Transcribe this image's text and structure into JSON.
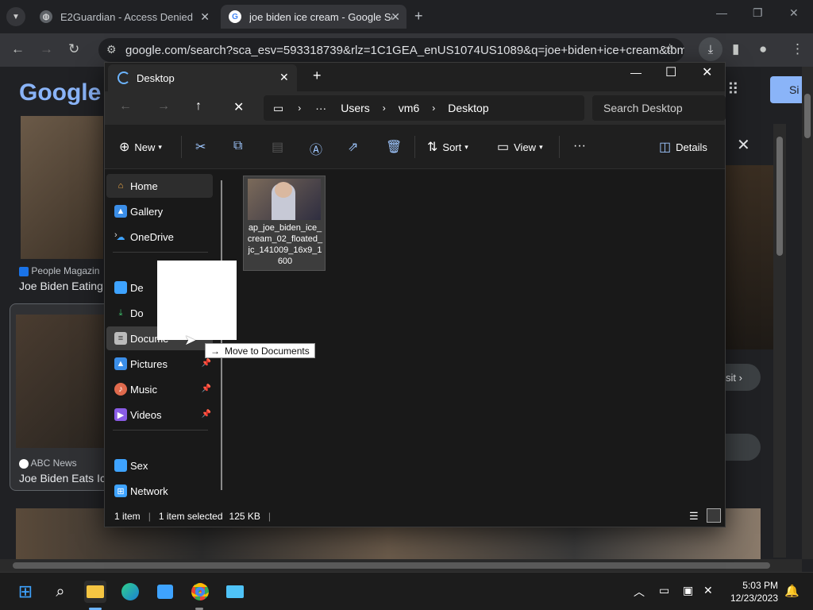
{
  "browser": {
    "tabs": [
      {
        "title": "E2Guardian - Access Denied"
      },
      {
        "title": "joe biden ice cream - Google Se"
      }
    ],
    "url": "google.com/search?sca_esv=593318739&rlz=1C1GEA_enUS1074US1089&q=joe+biden+ice+cream&tbm..."
  },
  "google": {
    "logo": "Google",
    "signin_fragment": "Si",
    "result1_source": "People Magazin",
    "result1_title": "Joe Biden Eating",
    "result2_source": "ABC News",
    "result2_title": "Joe Biden Eats Ic",
    "visit_fragment": "sit"
  },
  "explorer": {
    "tab_title": "Desktop",
    "breadcrumb": [
      "Users",
      "vm6",
      "Desktop"
    ],
    "search_placeholder": "Search Desktop",
    "commands": {
      "new": "New",
      "sort": "Sort",
      "view": "View",
      "details": "Details"
    },
    "nav": [
      {
        "label": "Home"
      },
      {
        "label": "Gallery"
      },
      {
        "label": "OneDrive"
      },
      {
        "label": "De"
      },
      {
        "label": "Do"
      },
      {
        "label": "Docume"
      },
      {
        "label": "Pictures"
      },
      {
        "label": "Music"
      },
      {
        "label": "Videos"
      },
      {
        "label": "Sex"
      },
      {
        "label": "Network"
      }
    ],
    "file": {
      "name": "ap_joe_biden_ice_cream_02_floated_jc_141009_16x9_1600"
    },
    "tooltip": "Move to Documents",
    "status": {
      "count": "1 item",
      "selected": "1 item selected",
      "size": "125 KB"
    }
  },
  "taskbar": {
    "time": "5:03 PM",
    "date": "12/23/2023"
  }
}
